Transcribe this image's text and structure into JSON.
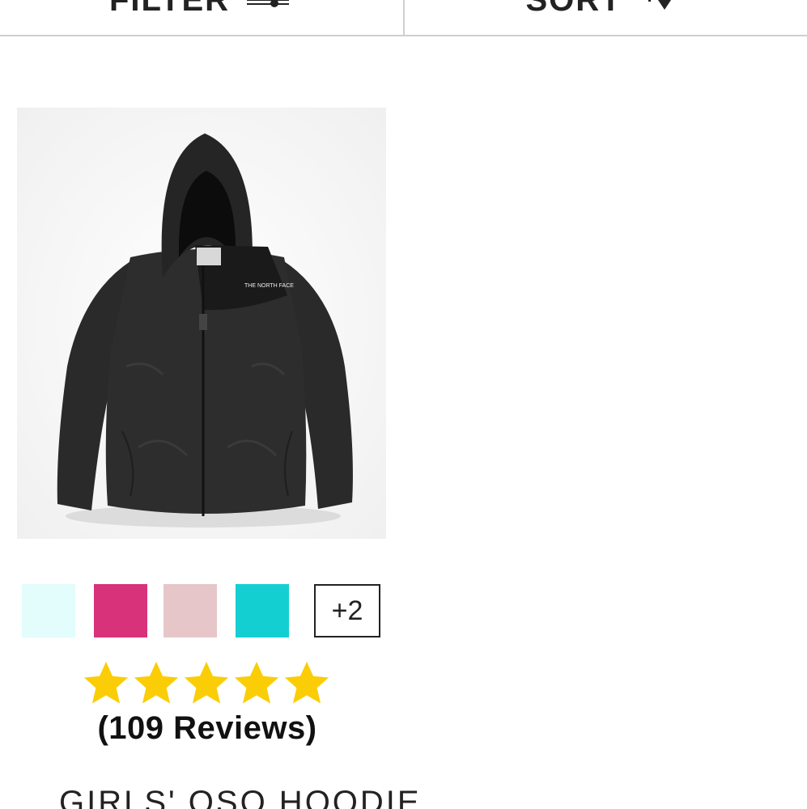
{
  "toolbar": {
    "filter_label": "FILTER",
    "sort_label": "SORT"
  },
  "product": {
    "image_alt": "Girls' Oso Hoodie black fleece jacket",
    "swatches": [
      {
        "color": "#e3fcfc",
        "name": "swatch-light-aqua"
      },
      {
        "color": "#d7327a",
        "name": "swatch-pink"
      },
      {
        "color": "#e6c6c9",
        "name": "swatch-blush"
      },
      {
        "color": "#14cfd2",
        "name": "swatch-turquoise"
      }
    ],
    "more_colors": "+2",
    "rating": 5,
    "rating_max": 5,
    "star_color": "#fbcd07",
    "reviews_label": "(109 Reviews)",
    "title": "GIRLS' OSO HOODIE"
  }
}
